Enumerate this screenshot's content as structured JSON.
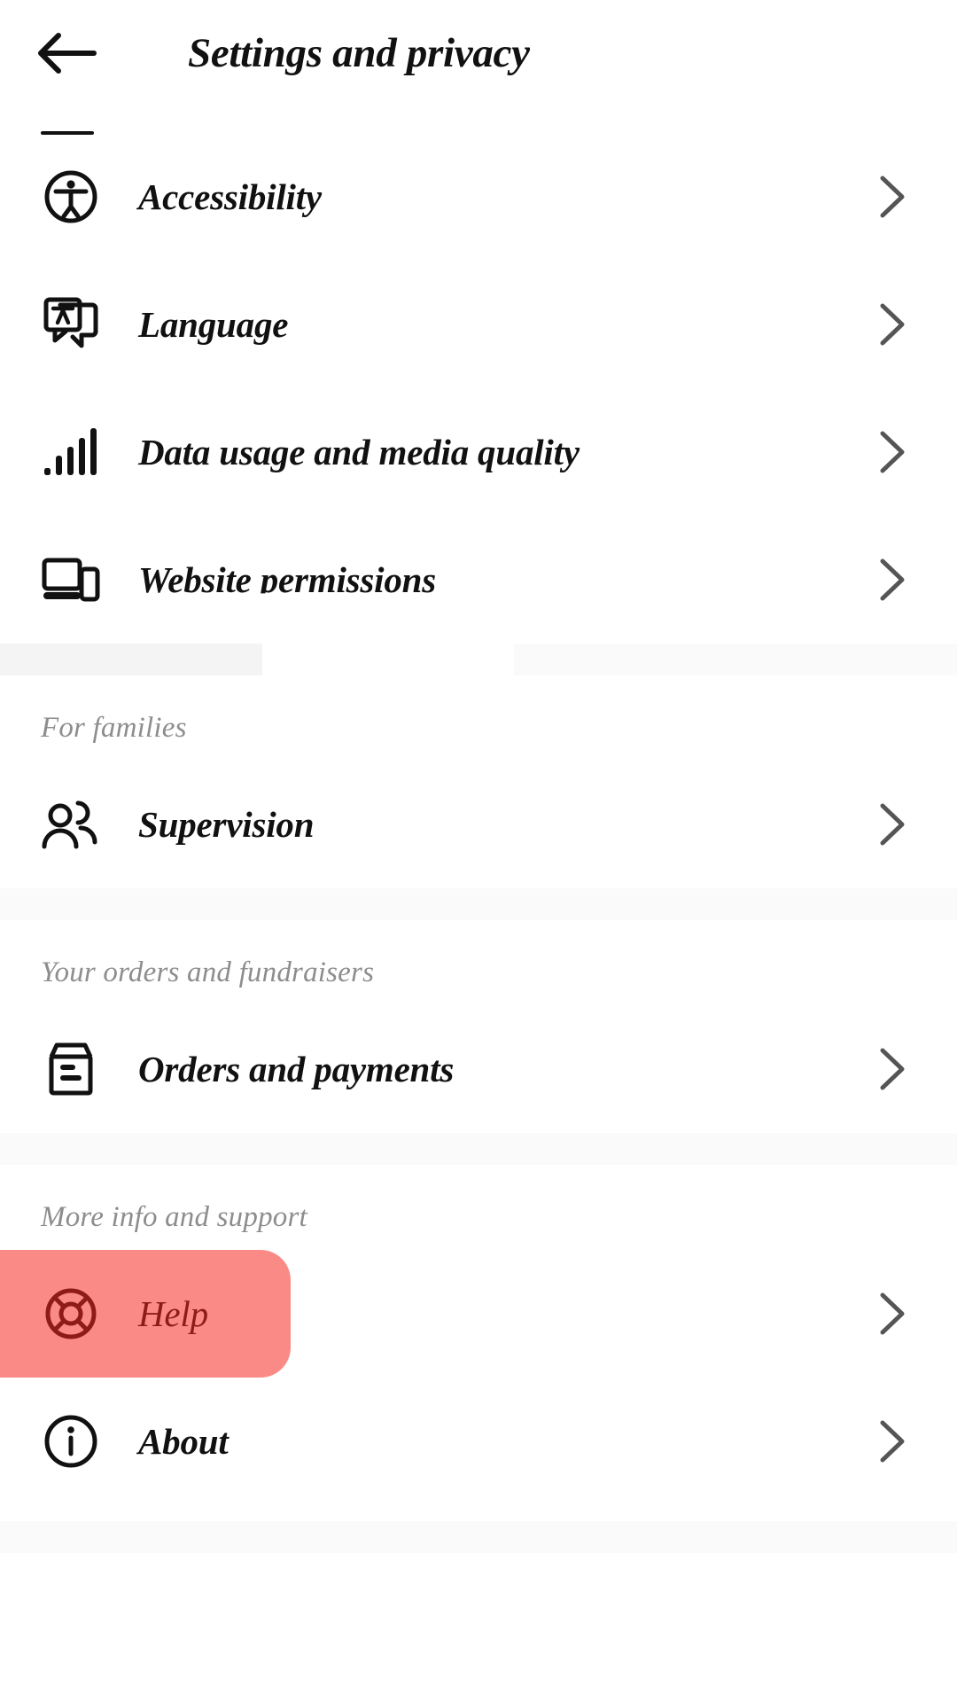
{
  "header": {
    "title": "Settings and privacy",
    "back_icon": "arrow-left-icon"
  },
  "sections": [
    {
      "key": "general",
      "title": null,
      "items": [
        {
          "label": "Accessibility",
          "icon": "accessibility-icon",
          "chevron": "chevron-right-icon"
        },
        {
          "label": "Language",
          "icon": "language-icon",
          "chevron": "chevron-right-icon"
        },
        {
          "label": "Data usage and media quality",
          "icon": "signal-bars-icon",
          "chevron": "chevron-right-icon"
        },
        {
          "label": "Website permissions",
          "icon": "devices-icon",
          "chevron": "chevron-right-icon"
        }
      ]
    },
    {
      "key": "families",
      "title": "For families",
      "items": [
        {
          "label": "Supervision",
          "icon": "people-icon",
          "chevron": "chevron-right-icon"
        }
      ]
    },
    {
      "key": "orders",
      "title": "Your orders and fundraisers",
      "items": [
        {
          "label": "Orders and payments",
          "icon": "box-icon",
          "chevron": "chevron-right-icon"
        }
      ]
    },
    {
      "key": "support",
      "title": "More info and support",
      "items": [
        {
          "label": "Help",
          "icon": "lifebuoy-icon",
          "chevron": "chevron-right-icon",
          "highlighted": true
        },
        {
          "label": "About",
          "icon": "info-circle-icon",
          "chevron": "chevron-right-icon"
        }
      ]
    }
  ],
  "colors": {
    "highlight_fill": "#F98A86",
    "highlight_text": "#8E1B18",
    "section_title": "#8d8d8d",
    "row_label": "#111111",
    "divider": "#fafafa",
    "chevron": "#555555"
  }
}
